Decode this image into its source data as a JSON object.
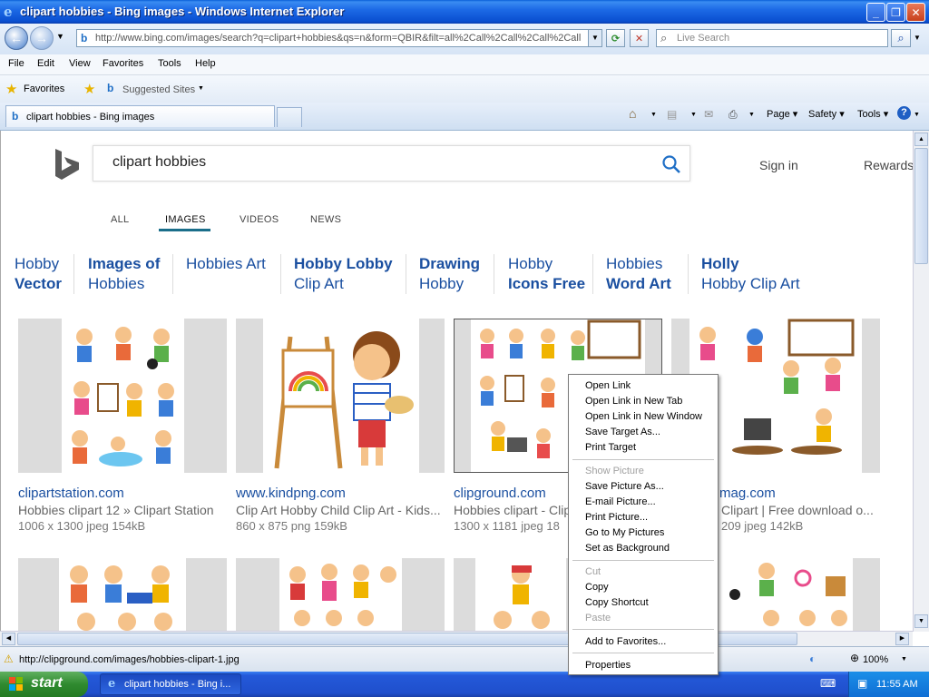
{
  "window": {
    "title": "clipart hobbies - Bing images - Windows Internet Explorer"
  },
  "address": {
    "url": "http://www.bing.com/images/search?q=clipart+hobbies&qs=n&form=QBIR&filt=all%2Call%2Call%2Call%2Call",
    "search_placeholder": "Live Search"
  },
  "menu": [
    "File",
    "Edit",
    "View",
    "Favorites",
    "Tools",
    "Help"
  ],
  "favorites_bar": {
    "favorites": "Favorites",
    "suggested": "Suggested Sites"
  },
  "tab": {
    "title": "clipart hobbies - Bing images"
  },
  "commands": {
    "page": "Page",
    "safety": "Safety",
    "tools": "Tools"
  },
  "bing": {
    "query": "clipart hobbies",
    "sign_in": "Sign in",
    "rewards": "Rewards",
    "tabs": [
      "ALL",
      "IMAGES",
      "VIDEOS",
      "NEWS"
    ],
    "active_tab": "IMAGES",
    "related": [
      {
        "l1": "Hobby",
        "l2": "Vector",
        "bold": "l2"
      },
      {
        "l1": "Images of",
        "l2": "Hobbies",
        "bold": "l1"
      },
      {
        "l1": "Hobbies Art",
        "l2": "",
        "bold": "none"
      },
      {
        "l1": "Hobby Lobby",
        "l2": "Clip Art",
        "bold": "l1"
      },
      {
        "l1": "Drawing",
        "l2": "Hobby",
        "bold": "l1"
      },
      {
        "l1": "Hobby",
        "l2": "Icons Free",
        "bold": "l2"
      },
      {
        "l1": "Hobbies",
        "l2": "Word Art",
        "bold": "l2"
      },
      {
        "l1": "Holly",
        "l2": "Hobby Clip Art",
        "bold": "l1"
      }
    ],
    "results": [
      {
        "site": "clipartstation.com",
        "title": "Hobbies clipart 12 » Clipart Station",
        "meta": "1006 x 1300 jpeg 154kB"
      },
      {
        "site": "www.kindpng.com",
        "title": "Clip Art Hobby Child Clip Art - Kids...",
        "meta": "860 x 875 png 159kB"
      },
      {
        "site": "clipground.com",
        "title": "Hobbies clipart - Clip",
        "meta": "1300 x 1181 jpeg 18"
      },
      {
        "site": "mag.com",
        "title": "Clipart | Free download o...",
        "meta": "209 jpeg 142kB"
      }
    ]
  },
  "context_menu": {
    "items": [
      {
        "label": "Open Link",
        "disabled": false
      },
      {
        "label": "Open Link in New Tab",
        "disabled": false
      },
      {
        "label": "Open Link in New Window",
        "disabled": false
      },
      {
        "label": "Save Target As...",
        "disabled": false
      },
      {
        "label": "Print Target",
        "disabled": false
      },
      {
        "label": "Show Picture",
        "disabled": true
      },
      {
        "label": "Save Picture As...",
        "disabled": false
      },
      {
        "label": "E-mail Picture...",
        "disabled": false
      },
      {
        "label": "Print Picture...",
        "disabled": false
      },
      {
        "label": "Go to My Pictures",
        "disabled": false
      },
      {
        "label": "Set as Background",
        "disabled": false
      },
      {
        "label": "Cut",
        "disabled": true
      },
      {
        "label": "Copy",
        "disabled": false
      },
      {
        "label": "Copy Shortcut",
        "disabled": false
      },
      {
        "label": "Paste",
        "disabled": true
      },
      {
        "label": "Add to Favorites...",
        "disabled": false
      },
      {
        "label": "Properties",
        "disabled": false
      }
    ]
  },
  "status": {
    "url": "http://clipground.com/images/hobbies-clipart-1.jpg",
    "zoom": "100%"
  },
  "taskbar": {
    "start": "start",
    "item": "clipart hobbies - Bing i...",
    "clock": "11:55 AM"
  },
  "colors": {
    "bing_link": "#1a4fa0",
    "titlebar": "#0a4fd0",
    "taskbar": "#2459d9",
    "start": "#2f8a2f"
  }
}
